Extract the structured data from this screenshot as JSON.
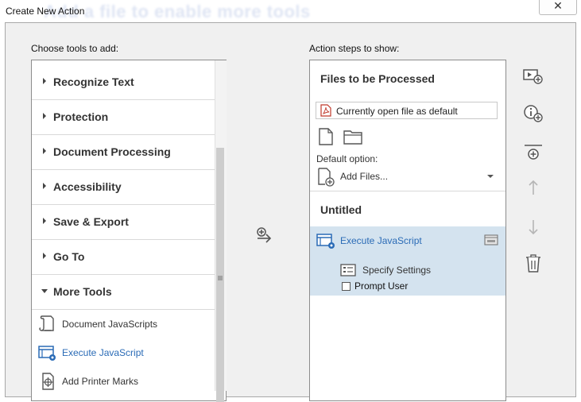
{
  "window": {
    "title": "Create New Action",
    "background_text": "Add a file to enable more tools",
    "close_symbol": "✕"
  },
  "left": {
    "label": "Choose tools to add:",
    "categories": [
      {
        "label": "Recognize Text",
        "expanded": false
      },
      {
        "label": "Protection",
        "expanded": false
      },
      {
        "label": "Document Processing",
        "expanded": false
      },
      {
        "label": "Accessibility",
        "expanded": false
      },
      {
        "label": "Save & Export",
        "expanded": false
      },
      {
        "label": "Go To",
        "expanded": false
      },
      {
        "label": "More Tools",
        "expanded": true
      }
    ],
    "tools": [
      {
        "label": "Document JavaScripts",
        "icon": "document-javascripts-icon",
        "highlighted": false
      },
      {
        "label": "Execute JavaScript",
        "icon": "execute-javascript-icon",
        "highlighted": true
      },
      {
        "label": "Add Printer Marks",
        "icon": "printer-marks-icon",
        "highlighted": false
      }
    ]
  },
  "middle": {
    "add_icon": "add-step-icon"
  },
  "right": {
    "label": "Action steps to show:",
    "files_header": "Files to be Processed",
    "file_select_value": "Currently open file as default",
    "default_option_label": "Default option:",
    "add_files_label": "Add Files...",
    "section_header": "Untitled",
    "step": {
      "label": "Execute JavaScript",
      "settings_label": "Specify Settings",
      "prompt_label": "Prompt User",
      "prompt_checked": false
    }
  },
  "side_toolbar": [
    {
      "icon": "add-panel-icon"
    },
    {
      "icon": "add-instruction-icon"
    },
    {
      "icon": "add-divider-icon"
    },
    {
      "icon": "move-up-icon",
      "enabled": false
    },
    {
      "icon": "move-down-icon",
      "enabled": false
    },
    {
      "icon": "delete-icon"
    }
  ],
  "colors": {
    "accent": "#2a6bb6",
    "selection": "#d4e3ef",
    "dialog_bg": "#f0f0f0"
  }
}
